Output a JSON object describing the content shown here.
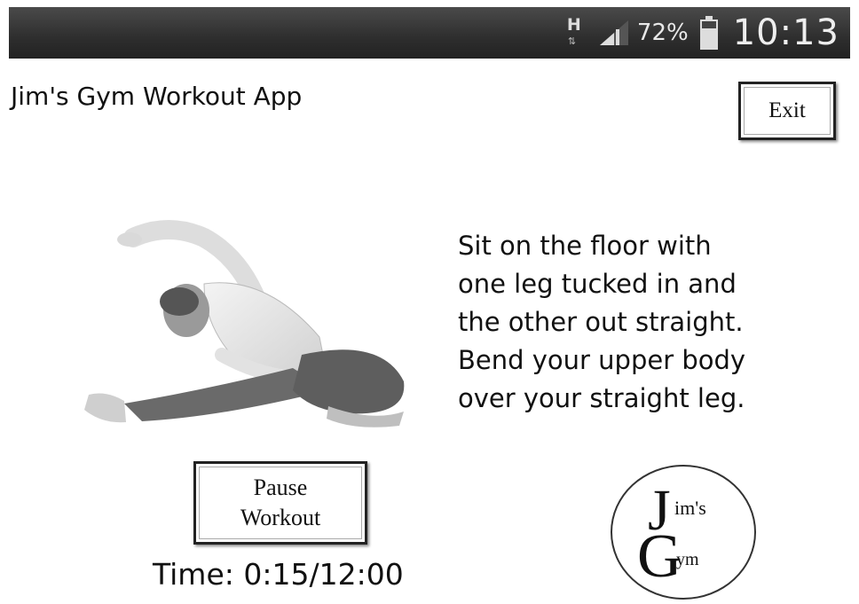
{
  "status_bar": {
    "network_type": "H",
    "battery_percent": "72%",
    "time": "10:13"
  },
  "app": {
    "title": "Jim's Gym Workout App",
    "exit_label": "Exit",
    "exercise_instructions": [
      "Sit on the floor with",
      "one leg tucked in and",
      "the other out straight.",
      "Bend your upper body",
      "over your straight leg."
    ],
    "pause_label_line1": "Pause",
    "pause_label_line2": "Workout",
    "timer": "Time: 0:15/12:00",
    "logo": {
      "letter_j": "J",
      "letter_g": "G",
      "text_top": "im's",
      "text_bottom": "ym"
    }
  },
  "colors": {
    "status_bar_bg": "#2e2e2e",
    "text": "#111111",
    "background": "#ffffff"
  },
  "icons": [
    "network-h-icon",
    "signal-strength-icon",
    "battery-icon"
  ]
}
